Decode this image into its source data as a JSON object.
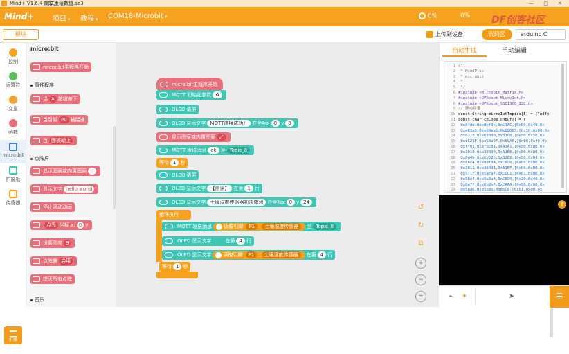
{
  "titlebar": {
    "app": "Mind+ V1.6.4 RC2.0",
    "file": "测试土壤数值.sb3",
    "controls": "— ▢ ✕"
  },
  "menubar": {
    "brand": "Mind+",
    "project": "项目",
    "tutorial": "教程",
    "port": "COM18-Microbit",
    "stat1": "0%",
    "stat2": "0%",
    "watermark": "DF创客社区"
  },
  "toolbar": {
    "modules": "模块",
    "upload": "上传到设备",
    "code": "代码区",
    "board": "arduino C"
  },
  "categories": [
    {
      "label": "控制",
      "color": "#f7a21e"
    },
    {
      "label": "运算符",
      "color": "#59c059"
    },
    {
      "label": "变量",
      "color": "#f4a335"
    },
    {
      "label": "函数",
      "color": "#e9707a"
    },
    {
      "label": "micro:bit",
      "color": "#4a7bd0"
    },
    {
      "label": "扩展板",
      "color": "#3fc6b4"
    },
    {
      "label": "传感器",
      "color": "#f7a21e"
    }
  ],
  "ext_label": "扩展",
  "palette": {
    "title": "micro:bit",
    "blocks": {
      "start": "micro:bit主程序开始",
      "section_events": "事件程序",
      "on_button": "当",
      "button_val": "A",
      "button_pressed": "按钮按下",
      "on_pin": "当引脚",
      "pin_val": "P0",
      "pin_touched": "被接通",
      "on_gesture": "当",
      "gesture_val": "面板朝上",
      "section_matrix": "点阵屏",
      "show_pattern": "显示图案或内置图案",
      "show_text": "显示文字",
      "text_val": "hello world",
      "stop_scroll": "停止滚动动画",
      "light": "点亮",
      "coord": "坐标",
      "x_label": "x:",
      "x_val": "0",
      "y_label": "y:",
      "brightness": "设置亮度",
      "bright_val": "9",
      "matrix_enable": "点阵屏",
      "enable_val": "启用",
      "clear": "熄灭所有点阵",
      "section_music": "音乐"
    }
  },
  "workspace": {
    "hat": "micro:bit主程序开始",
    "mqtt_init": "MQTT 初始化参数",
    "oled_clear1": "OLED 清屏",
    "oled_text1_pre": "OLED 显示文字",
    "oled_text1_val": "MQTT连接成功！",
    "oled_text1_mid": "在坐标x",
    "oled_text1_x": "8",
    "oled_text1_y_label": "y",
    "oled_text1_y": "8",
    "show_pattern": "显示图案或内置图案",
    "mqtt_send_pre": "MQTT 发送消息",
    "mqtt_send_val": "ok",
    "mqtt_send_to": "至",
    "topic": "Topic_0",
    "wait_label": "等待",
    "wait_val": "1",
    "wait_unit": "秒",
    "oled_clear2": "OLED 清屏",
    "oled_text2_pre": "OLED 显示文字",
    "oled_text2_val": "【测评】",
    "oled_text2_mid": "在第",
    "oled_text2_row": "1",
    "oled_text2_unit": "行",
    "oled_text3_pre": "OLED 显示文字",
    "oled_text3_val": "土壤湿度传感器初次体验",
    "oled_text3_mid": "在坐标x",
    "oled_text3_x": "0",
    "oled_text3_y_label": "y",
    "oled_text3_y": "24",
    "loop": "循环执行",
    "loop_mqtt_pre": "MQTT 发送消息",
    "read_pin": "读取引脚",
    "pin": "P1",
    "sensor": "土壤湿度传感器",
    "loop_to": "至",
    "loop_topic": "Topic_0",
    "loop_oled1_pre": "OLED 显示文字",
    "loop_oled1_val": "",
    "loop_oled1_mid": "在第",
    "loop_oled1_row": "4",
    "loop_oled1_unit": "行",
    "loop_oled2_pre": "OLED 显示文字",
    "loop_oled2_mid": "在第",
    "loop_oled2_row": "4",
    "loop_oled2_unit": "行",
    "loop_wait_label": "等待",
    "loop_wait_val": "1",
    "loop_wait_unit": "秒"
  },
  "code": {
    "tab_auto": "自动生成",
    "tab_manual": "手动编辑",
    "lines": [
      {
        "n": "1",
        "t": "/*!"
      },
      {
        "n": "2",
        "t": " * MindPlus"
      },
      {
        "n": "3",
        "t": " * microbit"
      },
      {
        "n": "4",
        "t": " *"
      },
      {
        "n": "5",
        "t": " */"
      },
      {
        "n": "6",
        "t": "#include <Microbit_Matrix.h>"
      },
      {
        "n": "7",
        "t": "#include <DFRobot_MicroIot.h>"
      },
      {
        "n": "8",
        "t": "#include <DFRobot_SSD1306_I2C.h>"
      },
      {
        "n": "9",
        "t": "// 静态常量"
      },
      {
        "n": "10",
        "t": "const String microIotTopics[5] = {\"ndfo"
      },
      {
        "n": "11",
        "t": "const char chCode chBuf[] = {"
      },
      {
        "n": "12",
        "t": "  0x8fde,0xe8bf9e,0xC1AC,[0x00,0x40,0x"
      },
      {
        "n": "13",
        "t": "  0xe63a5,0xe68ea5,0x8BD03,[0x10,0x08,0x"
      },
      {
        "n": "14",
        "t": "  0x6210,0xe68890,0x83C0,[0x00,0x50,0x"
      },
      {
        "n": "15",
        "t": "  0xe529F,0xe58a9F,0x89A6,[0x00,0x40,0x"
      },
      {
        "n": "16",
        "t": "  0xff01,0xefbc81,0xA3A1,[0x00,0x00,0x"
      },
      {
        "n": "17",
        "t": "  0x3010,0xe38090,0xA1BE,[0x00,0x00,0x"
      },
      {
        "n": "18",
        "t": "  0x6d4b,0xe6b58b,0xB2E2,[0x00,0x04,0x"
      },
      {
        "n": "19",
        "t": "  0x8bc4,0xe8af84,0xC6C0,[0x00,0x00,0x"
      },
      {
        "n": "20",
        "t": "  0x3011,0xe38091,0xA1BF,[0x00,0x00,0x"
      },
      {
        "n": "21",
        "t": "  0x571f,0xe59c9f,0xCDC1,[0x01,0x00,0x"
      },
      {
        "n": "22",
        "t": "  0x58e4,0xe5a3a4,0xC8C0,[0x20,0x40,0x"
      },
      {
        "n": "23",
        "t": "  0x6e7f,0xe6b9bf,0xCAAA,[0x00,0x00,0x"
      },
      {
        "n": "24",
        "t": "  0x5ea6,0xe5ba6,0xB6C8,[0x01,0x00,0x"
      }
    ]
  }
}
